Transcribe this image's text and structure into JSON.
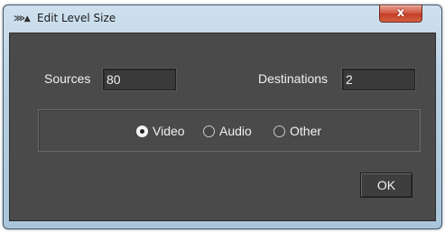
{
  "window": {
    "title": "Edit Level Size",
    "icon": "app-logo-icon",
    "close_label": "x"
  },
  "form": {
    "sources_label": "Sources",
    "sources_value": "80",
    "destinations_label": "Destinations",
    "destinations_value": "2"
  },
  "level_type": {
    "options": [
      {
        "label": "Video",
        "selected": true
      },
      {
        "label": "Audio",
        "selected": false
      },
      {
        "label": "Other",
        "selected": false
      }
    ]
  },
  "buttons": {
    "ok_label": "OK"
  },
  "colors": {
    "dialog_background": "#4a4a4a",
    "title_bar": "#b6cfe2",
    "close_button": "#c23d27"
  }
}
